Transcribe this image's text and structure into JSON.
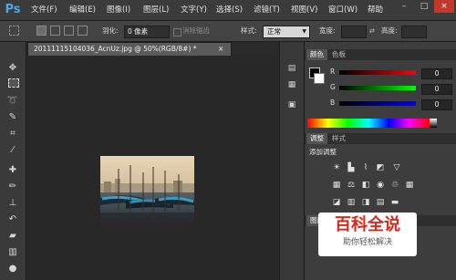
{
  "app": {
    "logo_text": "Ps"
  },
  "menu": [
    "文件(F)",
    "编辑(E)",
    "图像(I)",
    "图层(L)",
    "文字(Y)",
    "选择(S)",
    "滤镜(T)",
    "视图(V)",
    "窗口(W)",
    "帮助"
  ],
  "window_controls": {
    "minimize": "–",
    "restore": "□",
    "close": "×"
  },
  "options": {
    "feather_label": "羽化:",
    "feather_value": "0 像素",
    "antialias_label": "消除锯齿",
    "style_label": "样式:",
    "style_value": "正常",
    "width_label": "宽度:",
    "height_label": "高度:"
  },
  "document": {
    "tab_title": "20111115104036_AcnUz.jpg @ 50%(RGB/8#) *",
    "close": "×"
  },
  "panels": {
    "color_tabs": [
      "颜色",
      "色板"
    ],
    "channels": [
      {
        "label": "R",
        "value": "0",
        "gradient": [
          "#000000",
          "#ff0000"
        ]
      },
      {
        "label": "G",
        "value": "0",
        "gradient": [
          "#000000",
          "#00ff00"
        ]
      },
      {
        "label": "B",
        "value": "0",
        "gradient": [
          "#000000",
          "#0000ff"
        ]
      }
    ],
    "adjust_tabs": [
      "调整",
      "样式"
    ],
    "adjust_title": "添加调整",
    "layers_tab_partial": "图层"
  },
  "watermark": {
    "title": "百科全说",
    "subtitle": "助你轻松解决"
  },
  "colors": {
    "accent": "#4fa6e6",
    "watermark_red": "#d42a1f"
  }
}
